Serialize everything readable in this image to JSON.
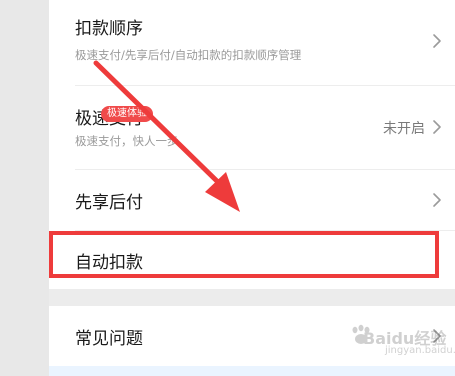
{
  "menu": {
    "deduction_order": {
      "title": "扣款顺序",
      "subtitle": "极速支付/先享后付/自动扣款的扣款顺序管理"
    },
    "fast_pay": {
      "title": "极速支付",
      "badge": "极速体验",
      "subtitle": "极速支付，快人一步",
      "status": "未开启"
    },
    "pay_later": {
      "title": "先享后付"
    },
    "auto_deduct": {
      "title": "自动扣款"
    },
    "faq": {
      "title": "常见问题"
    }
  },
  "watermark": {
    "brand": "Baidu经验",
    "url": "jingyan.baidu.com"
  },
  "colors": {
    "accent_red": "#ee3b3b",
    "badge_red": "#f04a4a",
    "background": "#ececec",
    "card": "#ffffff"
  }
}
